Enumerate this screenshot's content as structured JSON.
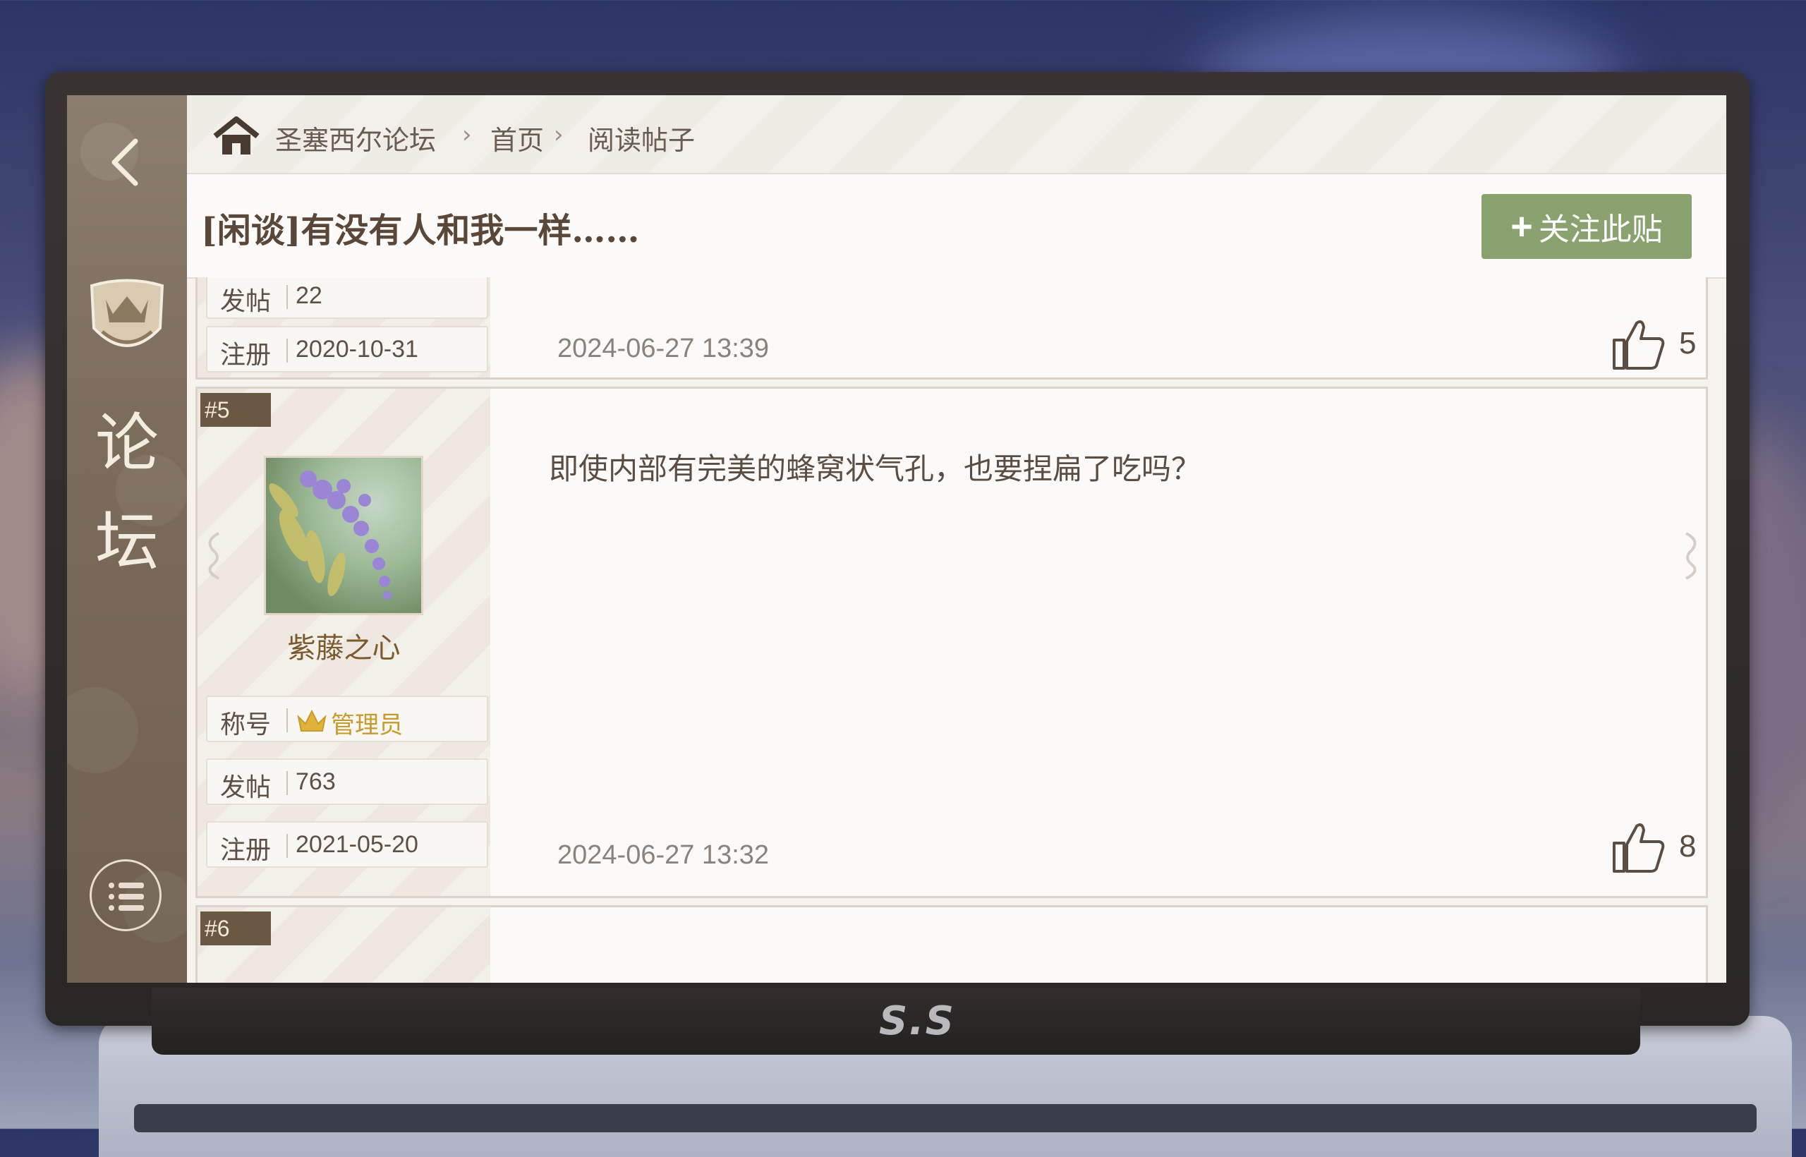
{
  "breadcrumb": {
    "forum": "圣塞西尔论坛",
    "home": "首页",
    "current": "阅读帖子"
  },
  "thread": {
    "title": "[闲谈]有没有人和我一样……",
    "follow_label": "关注此贴"
  },
  "sidebar": {
    "title_line1": "论",
    "title_line2": "坛"
  },
  "brand": "S.S",
  "posts": [
    {
      "info": [
        {
          "label": "发帖",
          "value": "22"
        },
        {
          "label": "注册",
          "value": "2020-10-31"
        }
      ],
      "timestamp": "2024-06-27  13:39",
      "likes": "5"
    },
    {
      "floor": "#5",
      "username": "紫藤之心",
      "info": [
        {
          "label": "称号",
          "value": "管理员"
        },
        {
          "label": "发帖",
          "value": "763"
        },
        {
          "label": "注册",
          "value": "2021-05-20"
        }
      ],
      "content": "即使内部有完美的蜂窝状气孔，也要捏扁了吃吗？",
      "timestamp": "2024-06-27  13:32",
      "likes": "8"
    },
    {
      "floor": "#6"
    }
  ],
  "colors": {
    "accent_green": "#8aa170",
    "admin_gold": "#c89a2c",
    "floor_tag": "#6b5842"
  }
}
